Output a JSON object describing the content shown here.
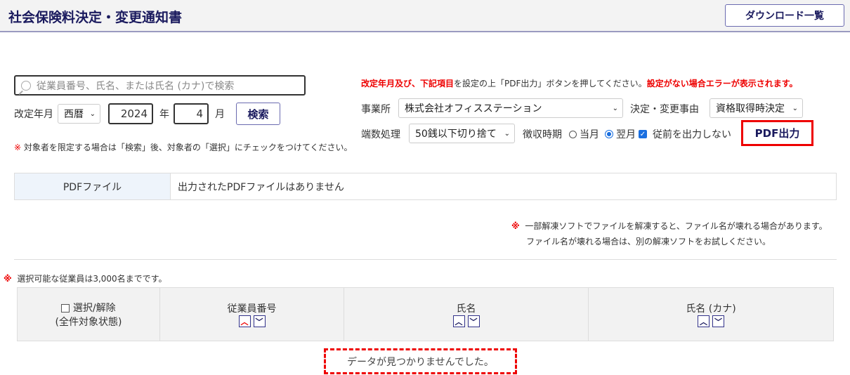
{
  "header": {
    "title": "社会保険料決定・変更通知書",
    "download_list": "ダウンロード一覧"
  },
  "search": {
    "placeholder": "従業員番号、氏名、または氏名 (カナ)で検索",
    "revision_label": "改定年月",
    "era": "西暦",
    "year": "2024",
    "year_unit": "年",
    "month": "4",
    "month_unit": "月",
    "search_button": "検索",
    "note_mark": "※",
    "note": "対象者を限定する場合は「検索」後、対象者の「選択」にチェックをつけてください。"
  },
  "settings": {
    "instruction_red1": "改定年月及び、下記項目",
    "instruction_mid": "を設定の上「PDF出力」ボタンを押してください。",
    "instruction_red2": "設定がない場合エラーが表示されます。",
    "office_label": "事業所",
    "office_value": "株式会社オフィスステーション",
    "reason_label": "決定・変更事由",
    "reason_value": "資格取得時決定",
    "rounding_label": "端数処理",
    "rounding_value": "50銭以下切り捨て",
    "collection_label": "徴収時期",
    "radio_current": "当月",
    "radio_next": "翌月",
    "radio_selected": "翌月",
    "no_previous_label": "従前を出力しない",
    "no_previous_checked": true,
    "pdf_button": "PDF出力"
  },
  "pdf_file": {
    "label": "PDFファイル",
    "value": "出力されたPDFファイルはありません"
  },
  "unzip_note": {
    "mark": "※",
    "line1": "一部解凍ソフトでファイルを解凍すると、ファイル名が壊れる場合があります。",
    "line2": "ファイル名が壊れる場合は、別の解凍ソフトをお試しください。"
  },
  "employees": {
    "note_mark": "※",
    "note": "選択可能な従業員は3,000名までです。",
    "columns": [
      "選択/解除",
      "(全件対象状態)",
      "従業員番号",
      "氏名",
      "氏名 (カナ)"
    ],
    "empty": "データが見つかりませんでした。"
  },
  "colors": {
    "navy": "#1a1a5e",
    "red": "#e00000"
  }
}
